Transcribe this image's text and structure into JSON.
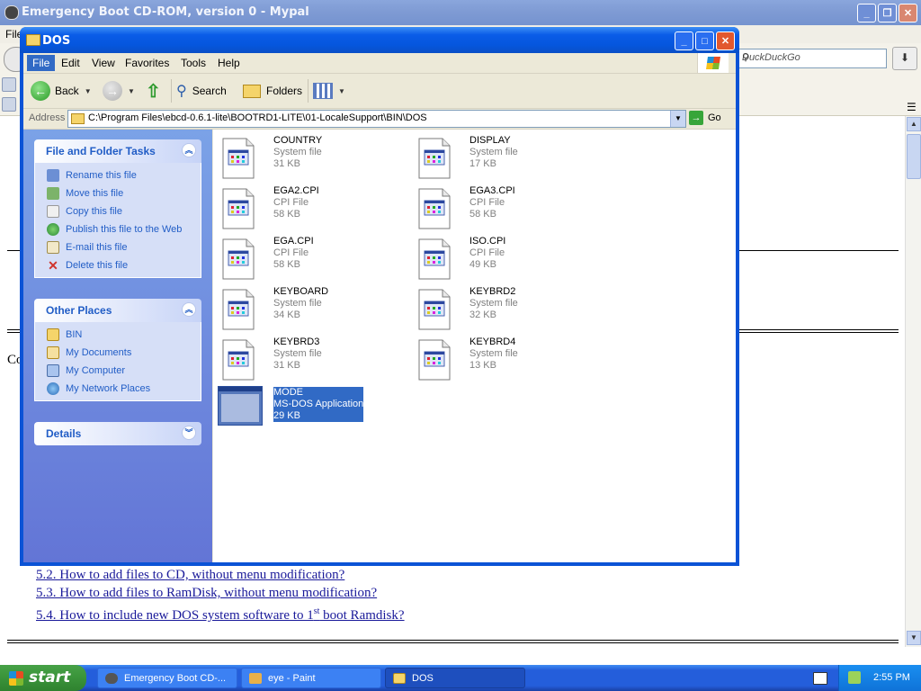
{
  "browser": {
    "title": "Emergency Boot CD-ROM, version 0 - Mypal",
    "menu_label": "File",
    "search_placeholder": "DuckDuckGo",
    "menu_glyph": "☰",
    "content_partial_text": "Co",
    "links": [
      "5.2. How to add files to CD, without menu modification?",
      "5.3. How to add files to RamDisk, without menu modification?",
      "5.4. How to include new DOS system software to 1",
      "st",
      " boot Ramdisk?"
    ]
  },
  "explorer": {
    "title": "DOS",
    "menu": [
      "File",
      "Edit",
      "View",
      "Favorites",
      "Tools",
      "Help"
    ],
    "toolbar": {
      "back": "Back",
      "search": "Search",
      "folders": "Folders"
    },
    "address_label": "Address",
    "address_value": "C:\\Program Files\\ebcd-0.6.1-lite\\BOOTRD1-LITE\\01-LocaleSupport\\BIN\\DOS",
    "go_label": "Go",
    "panels": {
      "file_tasks": {
        "title": "File and Folder Tasks",
        "items": [
          "Rename this file",
          "Move this file",
          "Copy this file",
          "Publish this file to the Web",
          "E-mail this file",
          "Delete this file"
        ]
      },
      "other_places": {
        "title": "Other Places",
        "items": [
          "BIN",
          "My Documents",
          "My Computer",
          "My Network Places"
        ]
      },
      "details": {
        "title": "Details"
      }
    },
    "files": [
      {
        "name": "COUNTRY",
        "type": "System file",
        "size": "31 KB"
      },
      {
        "name": "DISPLAY",
        "type": "System file",
        "size": "17 KB"
      },
      {
        "name": "EGA2.CPI",
        "type": "CPI File",
        "size": "58 KB"
      },
      {
        "name": "EGA3.CPI",
        "type": "CPI File",
        "size": "58 KB"
      },
      {
        "name": "EGA.CPI",
        "type": "CPI File",
        "size": "58 KB"
      },
      {
        "name": "ISO.CPI",
        "type": "CPI File",
        "size": "49 KB"
      },
      {
        "name": "KEYBOARD",
        "type": "System file",
        "size": "34 KB"
      },
      {
        "name": "KEYBRD2",
        "type": "System file",
        "size": "32 KB"
      },
      {
        "name": "KEYBRD3",
        "type": "System file",
        "size": "31 KB"
      },
      {
        "name": "KEYBRD4",
        "type": "System file",
        "size": "13 KB"
      },
      {
        "name": "MODE",
        "type": "MS-DOS Application",
        "size": "29 KB",
        "selected": true
      }
    ]
  },
  "taskbar": {
    "start_label": "start",
    "buttons": [
      "Emergency Boot CD-...",
      "eye - Paint",
      "DOS"
    ],
    "active_button": "DOS",
    "clock": "2:55 PM"
  }
}
